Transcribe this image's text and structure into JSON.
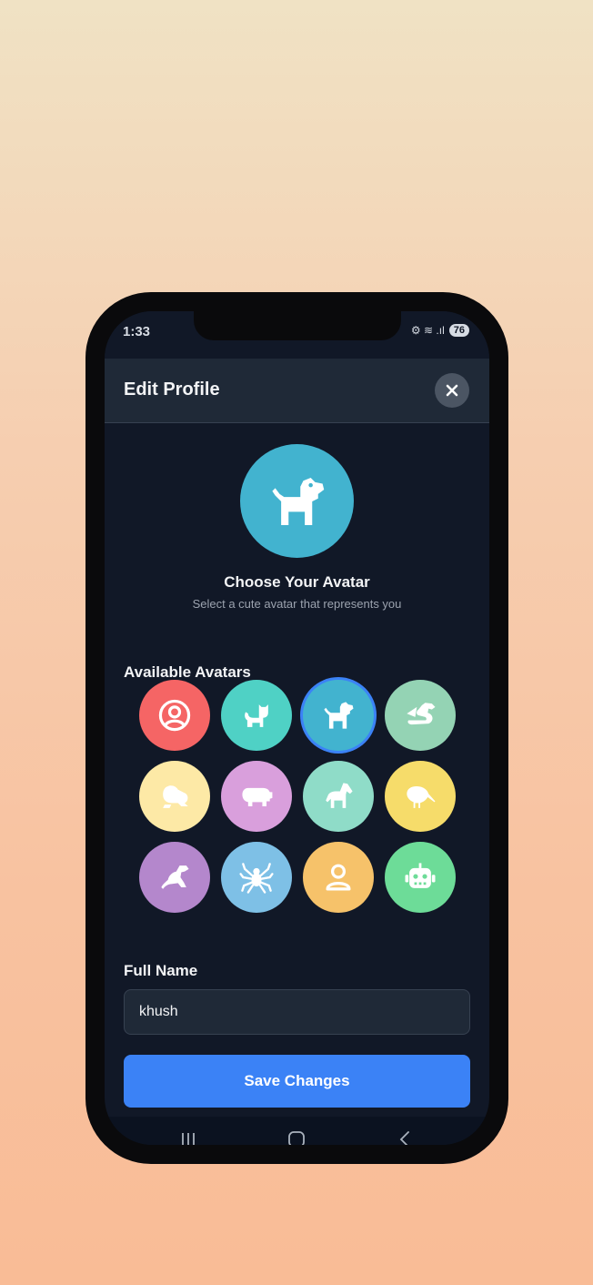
{
  "status": {
    "time": "1:33",
    "signal": "⚙ ≋ .ıl",
    "battery": "76"
  },
  "header": {
    "title": "Edit Profile"
  },
  "current_avatar": {
    "icon": "dog-icon",
    "color": "#42b3cf"
  },
  "chooser": {
    "title": "Choose Your Avatar",
    "subtitle": "Select a cute avatar that represents you"
  },
  "avatars": {
    "label": "Available Avatars",
    "selected_index": 2,
    "items": [
      {
        "icon": "user-circle-icon",
        "color": "#f56565"
      },
      {
        "icon": "cat-icon",
        "color": "#4fd1c5"
      },
      {
        "icon": "dog-icon",
        "color": "#42b3cf"
      },
      {
        "icon": "dragon-icon",
        "color": "#94d3b4"
      },
      {
        "icon": "frog-icon",
        "color": "#fde9a6"
      },
      {
        "icon": "hippo-icon",
        "color": "#d99fdc"
      },
      {
        "icon": "horse-icon",
        "color": "#8fdcc8"
      },
      {
        "icon": "kiwi-bird-icon",
        "color": "#f6dc6a"
      },
      {
        "icon": "otter-icon",
        "color": "#b487cc"
      },
      {
        "icon": "spider-icon",
        "color": "#7ec0e6"
      },
      {
        "icon": "user-icon",
        "color": "#f6c26a"
      },
      {
        "icon": "robot-icon",
        "color": "#6ddc98"
      }
    ]
  },
  "form": {
    "name_label": "Full Name",
    "name_value": "khush",
    "save_label": "Save Changes"
  },
  "colors": {
    "accent": "#3b82f6",
    "background": "#111827",
    "surface": "#1f2937"
  }
}
